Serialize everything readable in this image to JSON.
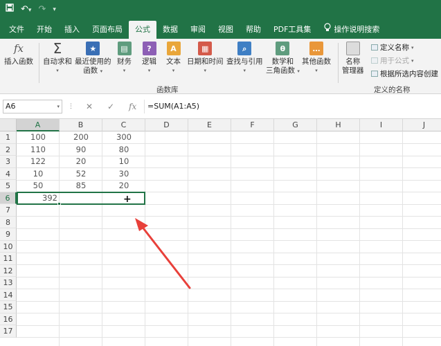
{
  "quick_access": {
    "save_icon": "save-icon",
    "undo_icon": "undo-icon",
    "redo_icon": "redo-icon",
    "customize_icon": "customize-icon"
  },
  "tabs": [
    {
      "label": "文件"
    },
    {
      "label": "开始"
    },
    {
      "label": "插入"
    },
    {
      "label": "页面布局"
    },
    {
      "label": "公式",
      "active": true
    },
    {
      "label": "数据"
    },
    {
      "label": "审阅"
    },
    {
      "label": "视图"
    },
    {
      "label": "帮助"
    },
    {
      "label": "PDF工具集"
    }
  ],
  "tell_me": "操作说明搜索",
  "ribbon": {
    "buttons": [
      {
        "label": "插入函数",
        "icon": "fx-icon"
      },
      {
        "label": "自动求和",
        "icon": "sigma-icon"
      },
      {
        "label": "最近使用的",
        "label2": "函数",
        "icon": "star-icon"
      },
      {
        "label": "财务",
        "icon": "finance-icon"
      },
      {
        "label": "逻辑",
        "icon": "logic-icon"
      },
      {
        "label": "文本",
        "icon": "text-icon"
      },
      {
        "label": "日期和时间",
        "icon": "datetime-icon"
      },
      {
        "label": "查找与引用",
        "icon": "lookup-icon"
      },
      {
        "label": "数学和",
        "label2": "三角函数",
        "icon": "math-icon"
      },
      {
        "label": "其他函数",
        "icon": "more-functions-icon"
      },
      {
        "label": "名称",
        "label2": "管理器",
        "icon": "name-manager-icon"
      }
    ],
    "group_function_library": "函数库",
    "define_name": "定义名称",
    "use_in_formula": "用于公式",
    "create_from_selection": "根据所选内容创建",
    "group_defined_names": "定义的名称",
    "accent": "#217346"
  },
  "formula_bar": {
    "name_box": "A6",
    "cancel": "✕",
    "enter": "✓",
    "fx": "fx",
    "formula": "=SUM(A1:A5)"
  },
  "sheet": {
    "columns": [
      "A",
      "B",
      "C",
      "D",
      "E",
      "F",
      "G",
      "H",
      "I",
      "J"
    ],
    "rows": [
      "1",
      "2",
      "3",
      "4",
      "5",
      "6",
      "7",
      "8",
      "9",
      "10",
      "11",
      "12",
      "13",
      "14",
      "15",
      "16",
      "17"
    ],
    "cells": [
      [
        "100",
        "200",
        "300"
      ],
      [
        "110",
        "90",
        "80"
      ],
      [
        "122",
        "20",
        "10"
      ],
      [
        "10",
        "52",
        "30"
      ],
      [
        "50",
        "85",
        "20"
      ],
      [
        "392",
        "",
        ""
      ]
    ],
    "cursor": "+"
  }
}
